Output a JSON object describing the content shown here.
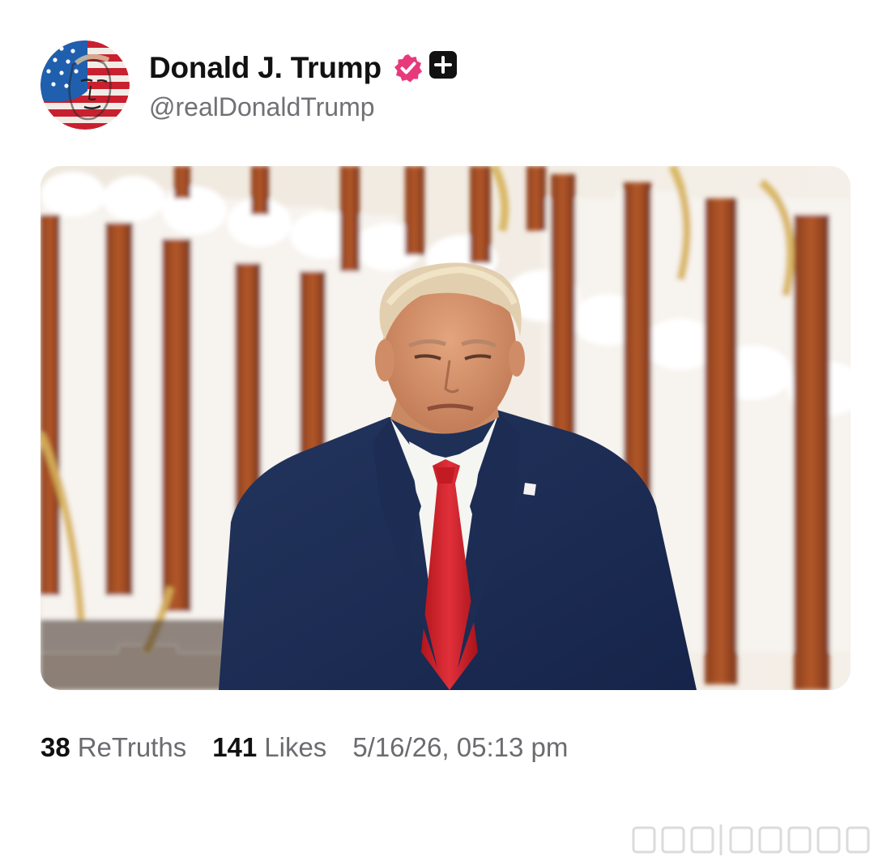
{
  "post": {
    "author": {
      "display_name": "Donald J. Trump",
      "handle": "@realDonaldTrump",
      "verified_icon": "verified-badge-icon",
      "follow_icon": "plus-icon"
    },
    "stats": {
      "retruths_count": "38",
      "retruths_label": "ReTruths",
      "likes_count": "141",
      "likes_label": "Likes",
      "timestamp": "5/16/26, 05:13 pm"
    }
  },
  "colors": {
    "verified_badge": "#e8397d",
    "name_text": "#111111",
    "secondary_text": "#6b6b70",
    "background": "#ffffff"
  }
}
